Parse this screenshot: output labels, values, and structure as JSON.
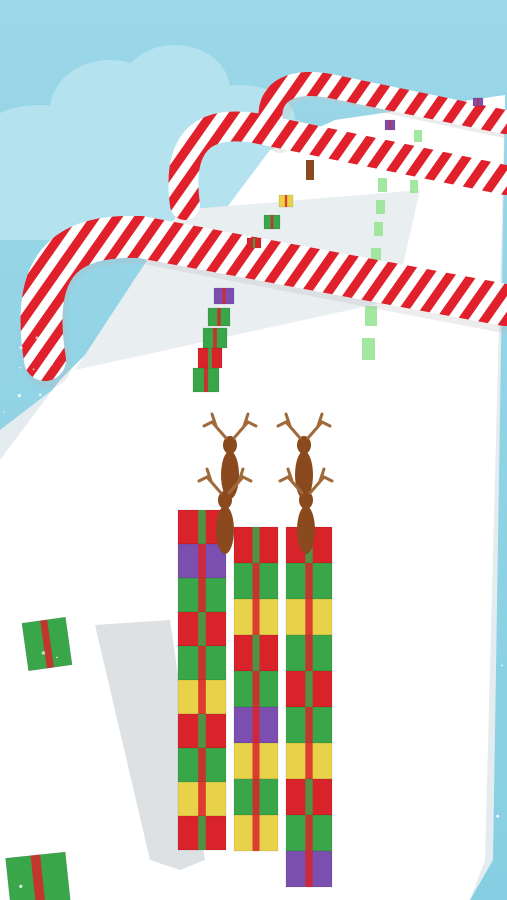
{
  "scene": {
    "type": "3d-runner-game",
    "theme": "christmas"
  },
  "colors": {
    "sky": "#8fd3e6",
    "cloud": "#b7e6f1",
    "track": "#ffffff",
    "track_shadow": "#dfe6ea",
    "candy_red": "#e0202a",
    "candy_white": "#ffffff",
    "gift_red": "#d9232a",
    "gift_green": "#3aa64a",
    "gift_yellow": "#e8d24a",
    "gift_purple": "#7a4fb0",
    "ribbon": "#f0f0f0",
    "reindeer": "#8a4a1e",
    "lane_marker": "#8fe08a"
  },
  "objects": {
    "candy_cane_arches": 3,
    "gift_tower_columns": [
      [
        "red",
        "purple",
        "green",
        "red",
        "green",
        "yellow",
        "red",
        "green",
        "yellow",
        "red"
      ],
      [
        "red",
        "green",
        "yellow",
        "red",
        "green",
        "purple",
        "yellow",
        "green",
        "yellow"
      ],
      [
        "red",
        "green",
        "yellow",
        "green",
        "red",
        "green",
        "yellow",
        "red",
        "green",
        "purple"
      ]
    ],
    "reindeer_count": 2,
    "icons": [
      "candy-cane-arch-icon",
      "gift-box-icon",
      "reindeer-icon"
    ]
  }
}
